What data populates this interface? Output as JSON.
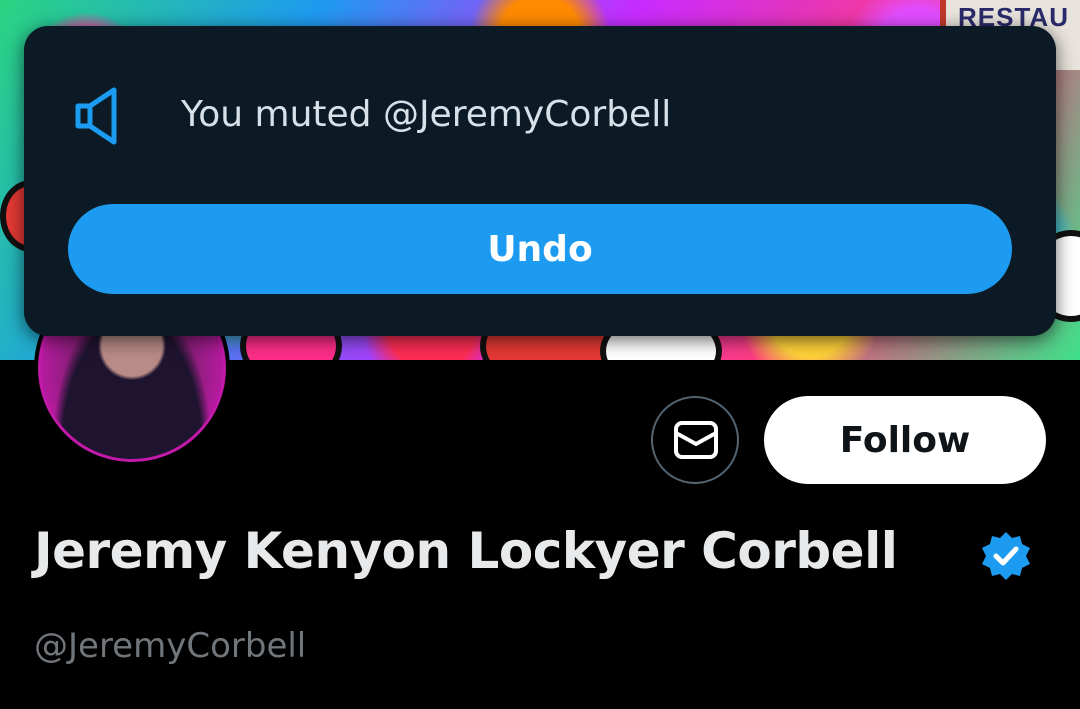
{
  "banner": {
    "sign_text": "RESTAU"
  },
  "toast": {
    "icon": "speaker-muted-icon",
    "message": "You muted @JeremyCorbell",
    "undo_label": "Undo",
    "accent_color": "#1d9bf0"
  },
  "profile": {
    "display_name": "Jeremy Kenyon Lockyer Corbell",
    "handle": "@JeremyCorbell",
    "verified": true,
    "verified_icon": "verified-badge-icon",
    "message_icon": "envelope-icon",
    "follow_label": "Follow"
  }
}
